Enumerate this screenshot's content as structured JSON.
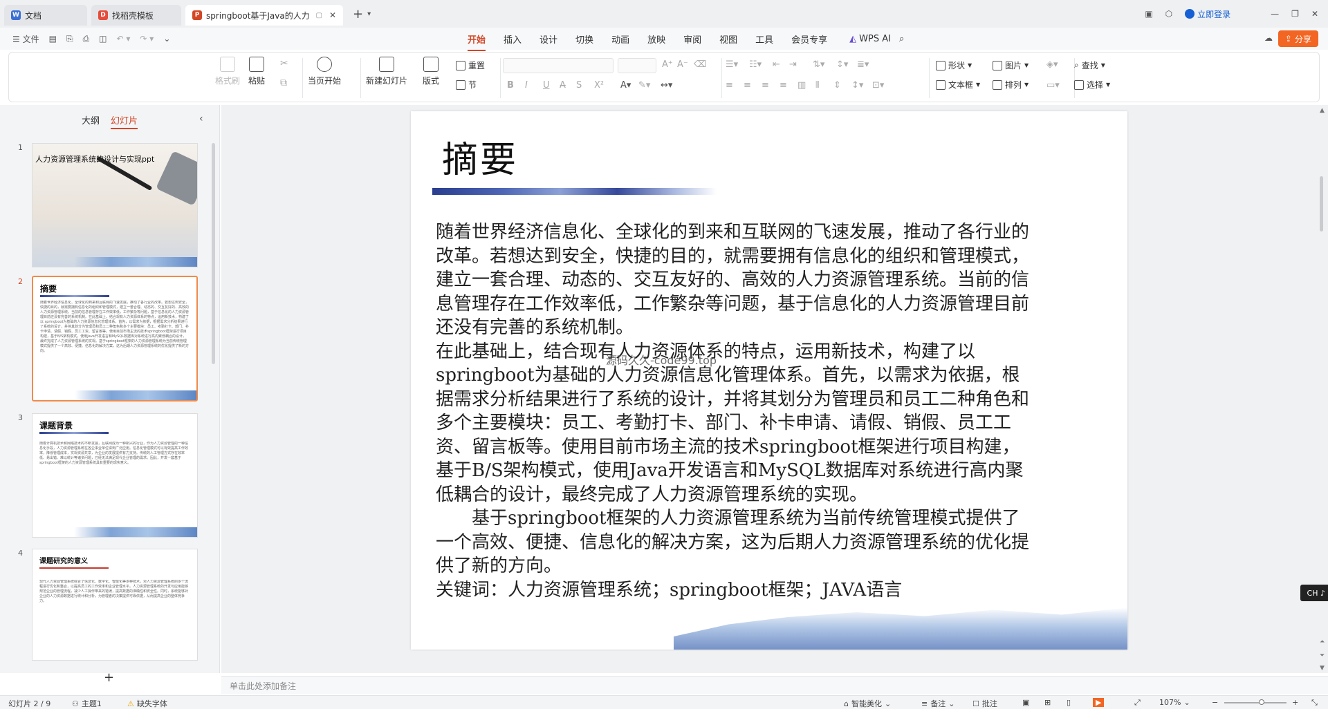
{
  "tabs": [
    {
      "label": "文档",
      "icon": "docs-icon",
      "color": "#3b6fd4"
    },
    {
      "label": "找稻壳模板",
      "icon": "docer-icon",
      "color": "#e64b3b"
    },
    {
      "label": "springboot基于Java的人力",
      "icon": "ppt-icon",
      "color": "#d24726"
    }
  ],
  "titlebar": {
    "login": "立即登录",
    "new_tab": "+"
  },
  "menu": {
    "file": "文件",
    "tabs": [
      "开始",
      "插入",
      "设计",
      "切换",
      "动画",
      "放映",
      "审阅",
      "视图",
      "工具",
      "会员专享"
    ],
    "active_tab": "开始",
    "wps_ai": "WPS AI",
    "share": "分享"
  },
  "ribbon": {
    "format_painter": "格式刷",
    "paste": "粘贴",
    "play_from_current": "当页开始",
    "new_slide": "新建幻灯片",
    "layout": "版式",
    "reset": "重置",
    "section": "节",
    "shape": "形状",
    "picture": "图片",
    "textbox": "文本框",
    "arrange": "排列",
    "find": "查找",
    "select": "选择"
  },
  "panel": {
    "outline_tab": "大纲",
    "slides_tab": "幻灯片",
    "active": "幻灯片",
    "add": "+"
  },
  "thumbnails": [
    {
      "num": "1",
      "title": "人力资源管理系统的设计与实现ppt",
      "text": ""
    },
    {
      "num": "2",
      "title": "摘要",
      "text": "随着世界经济信息化、全球化的到来和互联网的飞速发展，推动了各行业的改革。若想达到安全，快捷的目的，就需要拥有信息化的组织和管理模式，建立一套合理、动态的、交互友好的、高效的人力资源管理系统。当前的信息管理存在工作效率低，工作繁杂等问题，基于信息化的人力资源管理目前还没有完善的系统机制。在此基础上，结合现有人力资源体系的特点，运用新技术，构建了以 springboot为基础的人力资源信息化管理体系。首先，以需求为依据，根据需求分析结果进行了系统的设计，并将其划分为管理员和员工二种角色和多个主要模块：员工、考勤打卡、部门、补卡申请、请假、销假、员工工资、留言板等。使用目前市场主流的技术springboot框架进行项目构建，基于B/S架构模式，使用Java开发语言和MySQL数据库对系统进行高内聚低耦合的设计，最终完成了人力资源管理系统的实现。基于springboot框架的人力资源管理系统为当前传统管理模式提供了一个高效、便捷、信息化的解决方案，这为后期人力资源管理系统的优化提供了新的方向。"
    },
    {
      "num": "3",
      "title": "课题背景",
      "text": "随着计算机技术和网络技术的不断发展，互联网成为一种新兴的行业，作为人力资源管理的一种信息化手段，人力资源管理系统在各企事业单位得到广泛应用。信息化管理模式可以有效提高工作效率，降低管理成本，实现资源共享，为企业的发展提供有力支持。传统的人工管理方式存在效率低、易出错、难以统计等诸多问题，已经无法满足现代企业管理的需求。因此，开发一套基于springboot框架的人力资源管理系统具有重要的现实意义。"
    },
    {
      "num": "4",
      "title": "课题研究的意义",
      "text": "现代人力资源管理系统综合了信息化、数字化、智能化等多种技术，对人力资源管理系统的多个流程进行优化和整合，以提高员工的工作效率和企业管理水平。人力资源管理系统的开发与应用能够规范企业的管理流程，减少人工操作带来的错误，提高数据的准确性和安全性。同时，系统能够对企业的人力资源数据进行统计和分析，为管理者的决策提供可靠依据，从而提高企业的整体竞争力。"
    }
  ],
  "slide": {
    "title": "摘要",
    "paragraphs": [
      "随着世界经济信息化、全球化的到来和互联网的飞速发展，推动了各行业的改革。若想达到安全，快捷的目的，就需要拥有信息化的组织和管理模式，建立一套合理、动态的、交互友好的、高效的人力资源管理系统。当前的信息管理存在工作效率低，工作繁杂等问题，基于信息化的人力资源管理目前还没有完善的系统机制。",
      "在此基础上，结合现有人力资源体系的特点，运用新技术，构建了以 springboot为基础的人力资源信息化管理体系。首先，以需求为依据，根据需求分析结果进行了系统的设计，并将其划分为管理员和员工二种角色和多个主要模块：员工、考勤打卡、部门、补卡申请、请假、销假、员工工资、留言板等。使用目前市场主流的技术springboot框架进行项目构建，基于B/S架构模式，使用Java开发语言和MySQL数据库对系统进行高内聚低耦合的设计，最终完成了人力资源管理系统的实现。",
      "　　基于springboot框架的人力资源管理系统为当前传统管理模式提供了一个高效、便捷、信息化的解决方案，这为后期人力资源管理系统的优化提供了新的方向。",
      "关键词：人力资源管理系统；springboot框架；JAVA语言"
    ],
    "watermark": "源码久久-code99.top"
  },
  "notes_placeholder": "单击此处添加备注",
  "status": {
    "slide_count": "幻灯片 2 / 9",
    "theme": "主题1",
    "missing_font": "缺失字体",
    "smart_beautify": "智能美化",
    "notes": "备注",
    "comments": "批注",
    "zoom": "107%"
  },
  "ime": "CH ♪ 简"
}
